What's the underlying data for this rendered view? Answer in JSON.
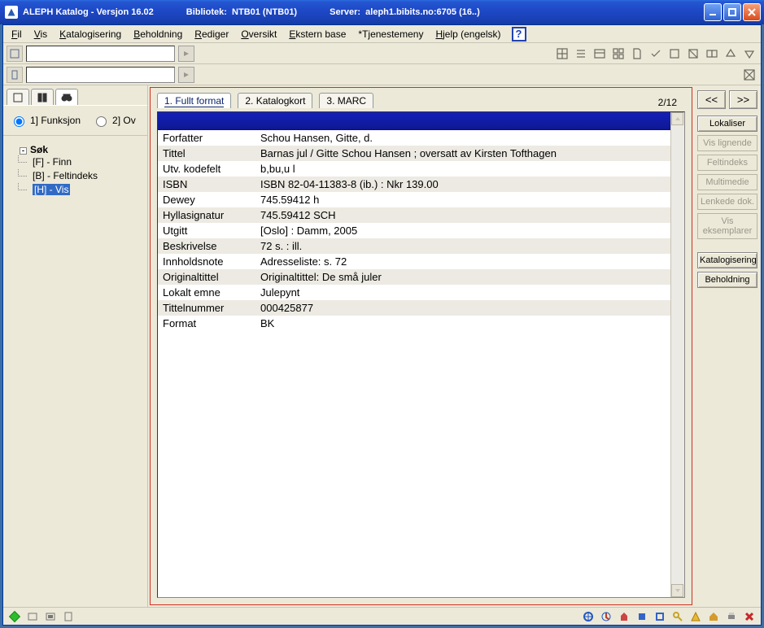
{
  "title": {
    "app": "ALEPH Katalog - Versjon 16.02",
    "lib_label": "Bibliotek:",
    "lib_value": "NTB01 (NTB01)",
    "server_label": "Server:",
    "server_value": "aleph1.bibits.no:6705 (16..)"
  },
  "menu": {
    "fil": "Fil",
    "vis": "Vis",
    "kat": "Katalogisering",
    "beh": "Beholdning",
    "red": "Rediger",
    "ove": "Oversikt",
    "ekst": "Ekstern base",
    "tjen": "*Tjenestemeny",
    "hjelp": "Hjelp (engelsk)"
  },
  "left": {
    "opt1": "1] Funksjon",
    "opt2": "2] Ov",
    "root": "Søk",
    "n1": "[F] - Finn",
    "n2": "[B] - Feltindeks",
    "n3": "[H] - Vis"
  },
  "tabs": {
    "t1": "1. Fullt format",
    "t2": "2. Katalogkort",
    "t3": "3. MARC",
    "counter": "2/12"
  },
  "record": [
    {
      "label": "Forfatter",
      "value": "Schou Hansen, Gitte, d."
    },
    {
      "label": "Tittel",
      "value": "Barnas jul / Gitte Schou Hansen ; oversatt av Kirsten Tofthagen"
    },
    {
      "label": "Utv. kodefelt",
      "value": "b,bu,u l"
    },
    {
      "label": "ISBN",
      "value": "ISBN 82-04-11383-8 (ib.)  : Nkr 139.00"
    },
    {
      "label": "Dewey",
      "value": "745.59412 h"
    },
    {
      "label": "Hyllasignatur",
      "value": "745.59412 SCH"
    },
    {
      "label": "Utgitt",
      "value": "[Oslo] : Damm, 2005"
    },
    {
      "label": "Beskrivelse",
      "value": "72 s. : ill."
    },
    {
      "label": "Innholdsnote",
      "value": "Adresseliste: s. 72"
    },
    {
      "label": "Originaltittel",
      "value": "Originaltittel: De små juler"
    },
    {
      "label": "Lokalt emne",
      "value": "Julepynt"
    },
    {
      "label": "Tittelnummer",
      "value": "000425877"
    },
    {
      "label": "Format",
      "value": "BK"
    }
  ],
  "buttons": {
    "prev": "<<",
    "next": ">>",
    "lokaliser": "Lokaliser",
    "vis_lignende": "Vis lignende",
    "feltindeks": "Feltindeks",
    "multimedie": "Multimedie",
    "lenkede": "Lenkede dok.",
    "eksemplarer": "Vis eksemplarer",
    "katalog": "Katalogisering",
    "behold": "Beholdning"
  }
}
